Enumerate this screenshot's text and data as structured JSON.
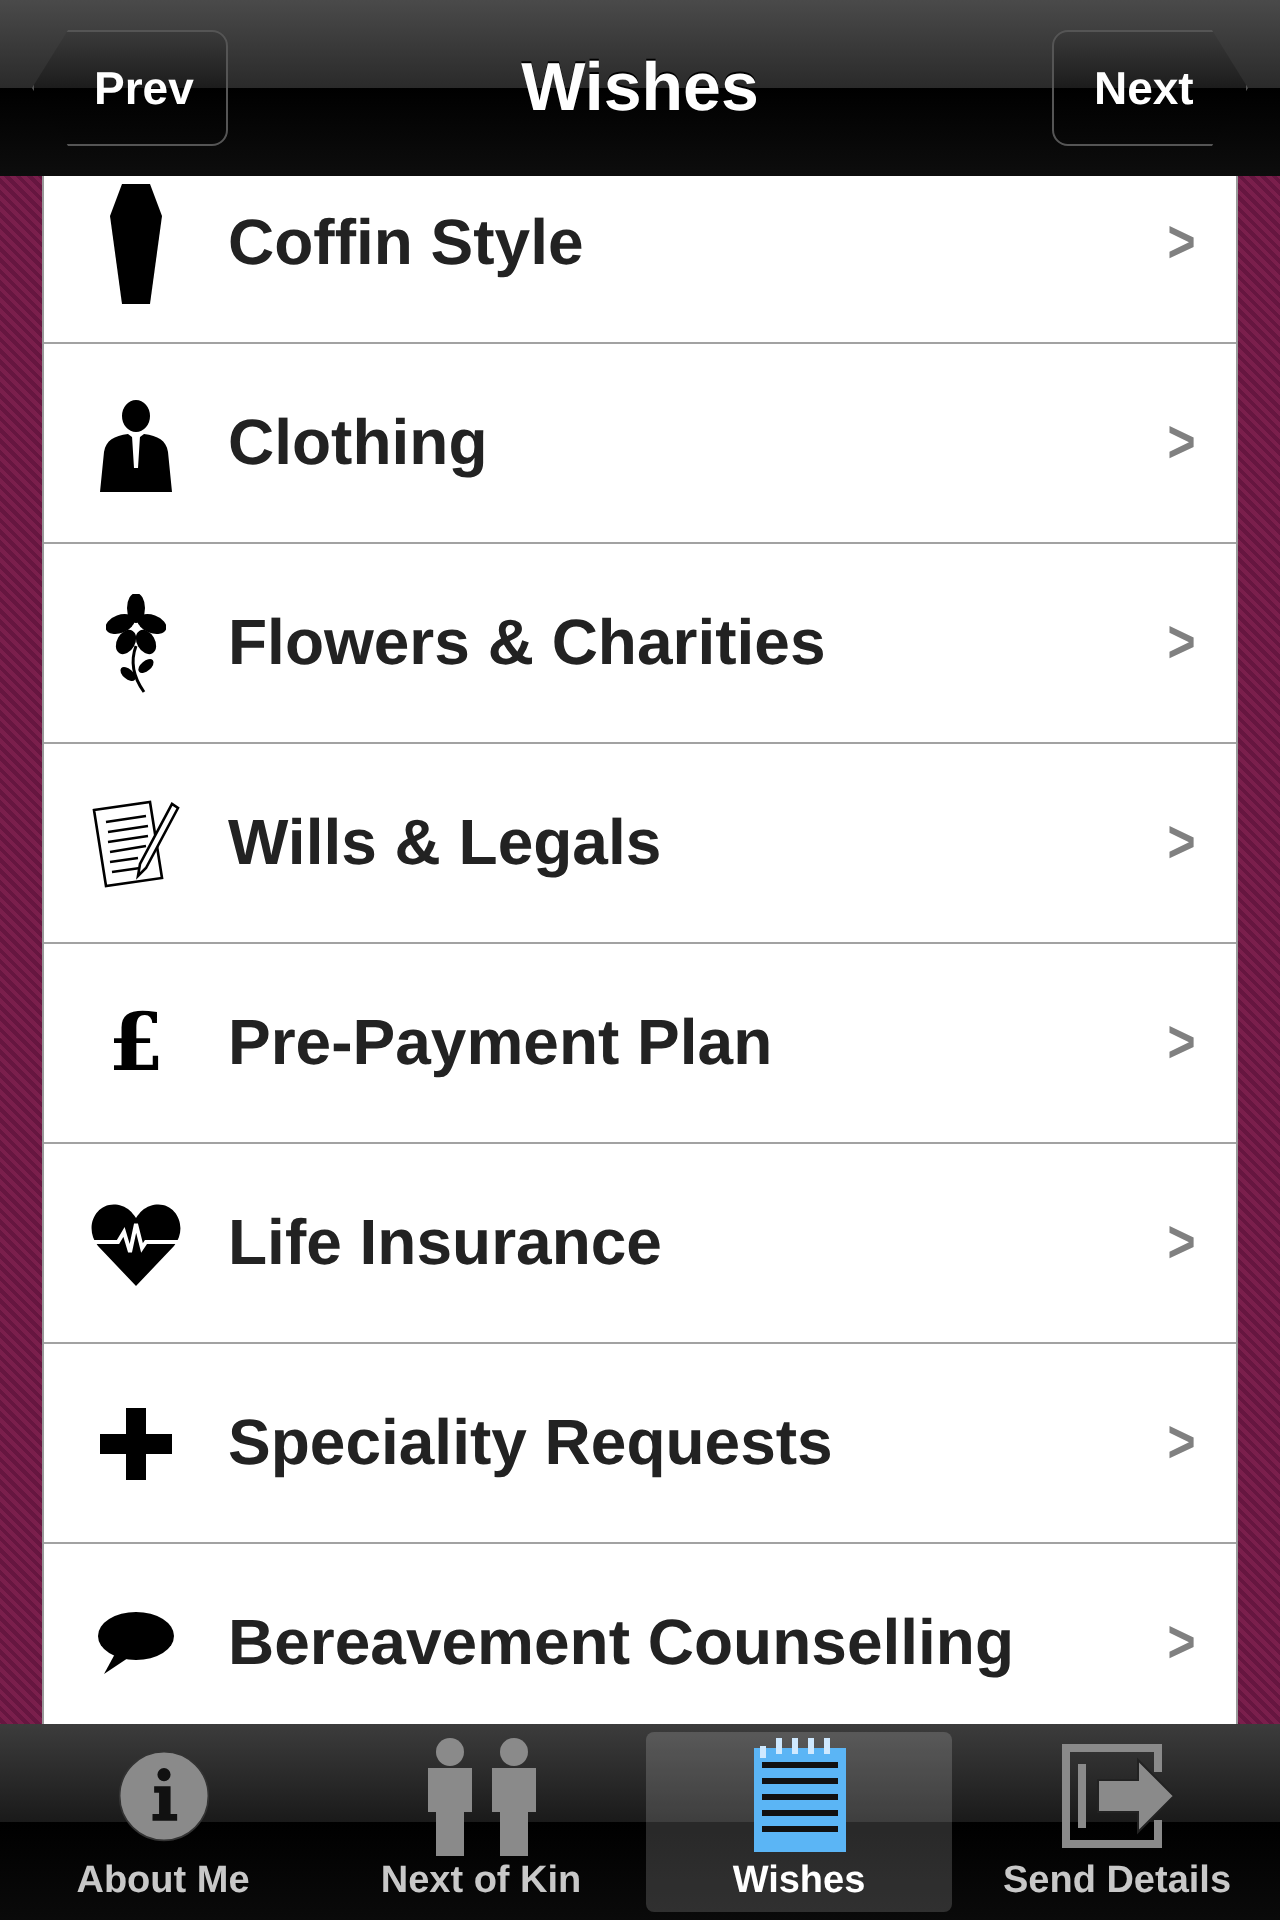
{
  "nav_bar": {
    "title": "Wishes",
    "back_button": "Prev",
    "forward_button": "Next"
  },
  "items": [
    {
      "kind": "coffin",
      "label": "Coffin Style",
      "chevron": ">"
    },
    {
      "kind": "suit",
      "label": "Clothing",
      "chevron": ">"
    },
    {
      "kind": "flower",
      "label": "Flowers & Charities",
      "chevron": ">"
    },
    {
      "kind": "document",
      "label": "Wills & Legals",
      "chevron": ">"
    },
    {
      "kind": "symbol",
      "symbol": "£",
      "label": "Pre-Payment Plan",
      "chevron": ">"
    },
    {
      "kind": "heart",
      "label": "Life Insurance",
      "chevron": ">"
    },
    {
      "kind": "plus",
      "label": "Speciality Requests",
      "chevron": ">"
    },
    {
      "kind": "speech",
      "label": "Bereavement Counselling",
      "chevron": ">"
    }
  ],
  "tab_bar": [
    {
      "kind": "info",
      "label": "About Me",
      "selected": false
    },
    {
      "kind": "people",
      "label": "Next of Kin",
      "selected": false
    },
    {
      "kind": "notepad",
      "label": "Wishes",
      "selected": true
    },
    {
      "kind": "exit",
      "label": "Send Details",
      "selected": false
    }
  ]
}
